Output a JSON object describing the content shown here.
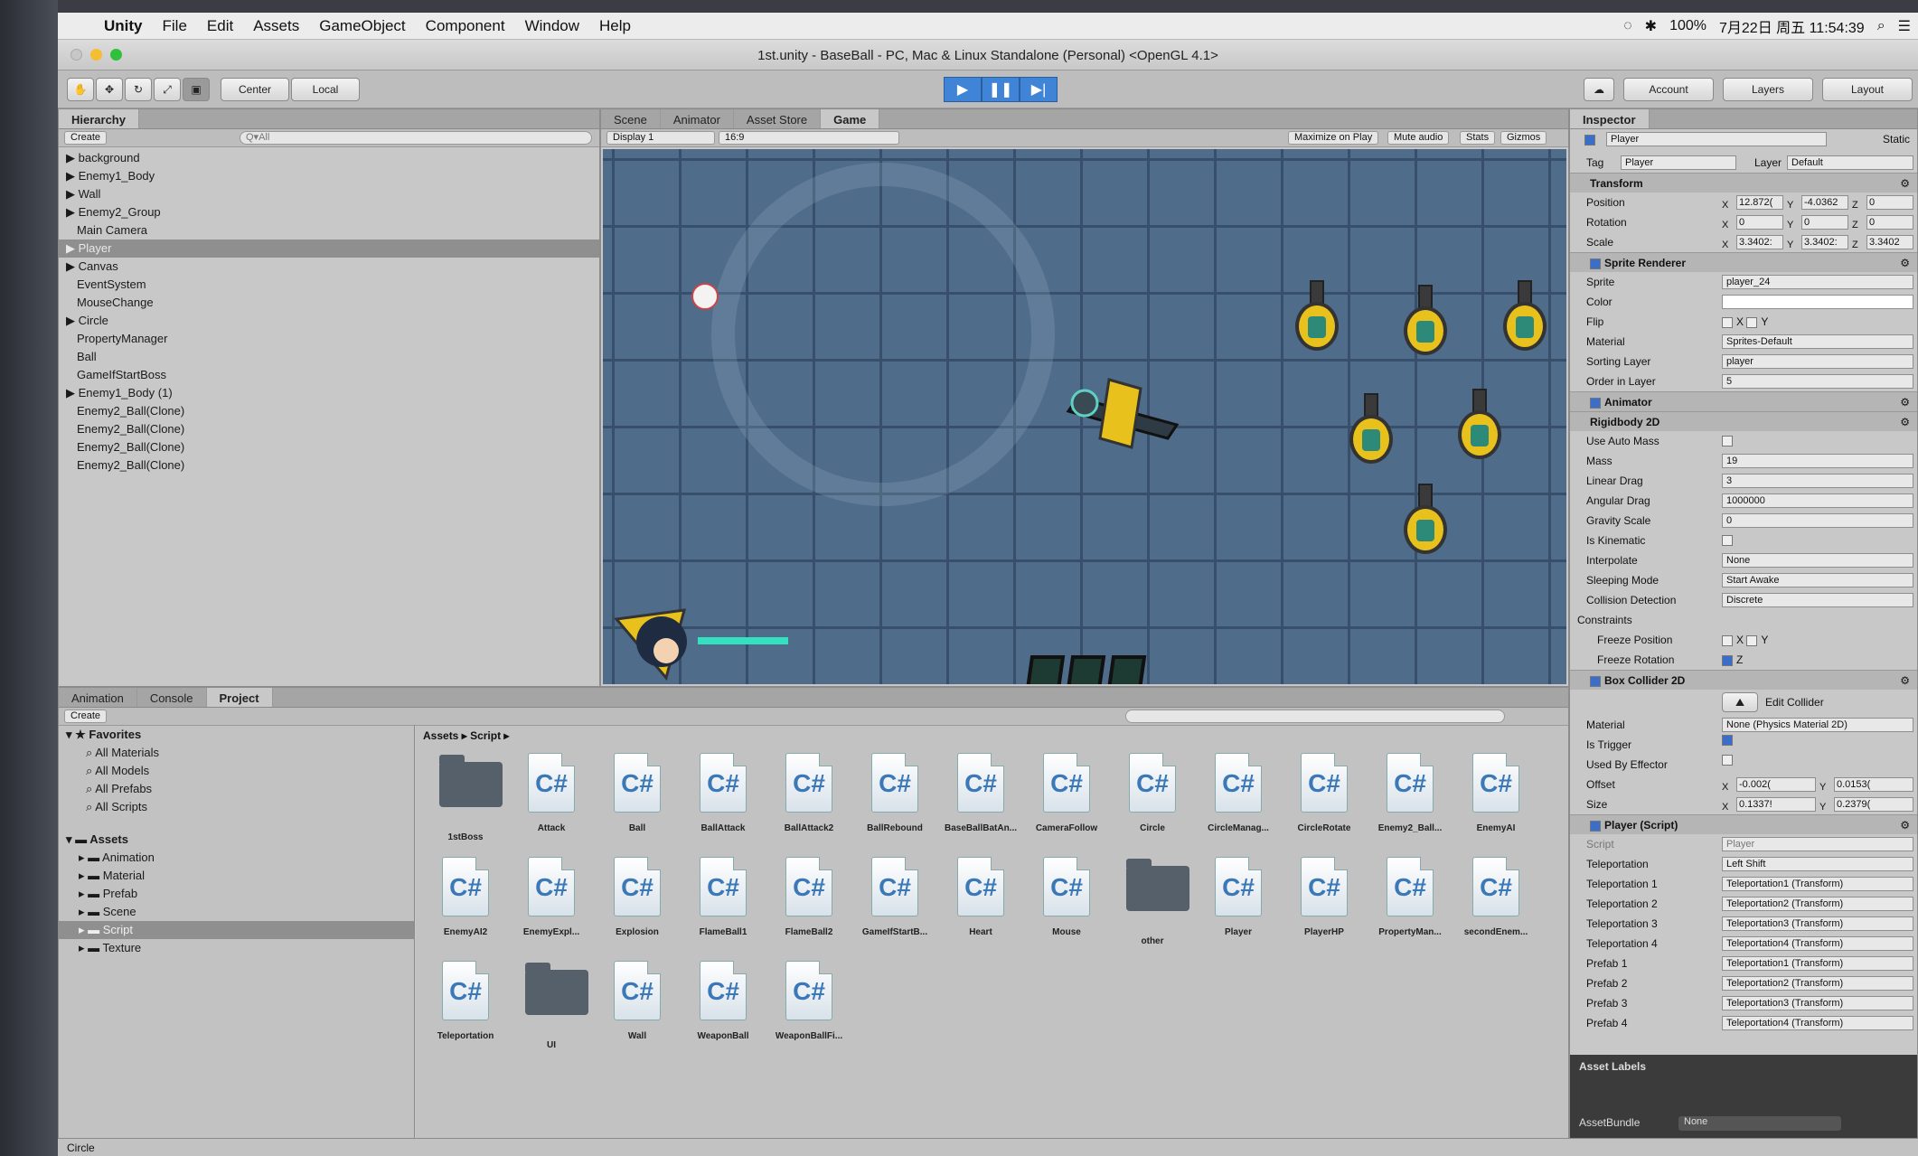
{
  "menubar": {
    "app": "Unity",
    "items": [
      "File",
      "Edit",
      "Assets",
      "GameObject",
      "Component",
      "Window",
      "Help"
    ],
    "status": {
      "battery": "100%",
      "date_time": "7月22日 周五 11:54:39"
    }
  },
  "window": {
    "title": "1st.unity - BaseBall - PC, Mac & Linux Standalone (Personal) <OpenGL 4.1>"
  },
  "toolbar": {
    "pivot": "Center",
    "space": "Local",
    "account": "Account",
    "layers": "Layers",
    "layout": "Layout"
  },
  "hierarchy": {
    "tab": "Hierarchy",
    "create": "Create",
    "search_placeholder": "Q▾All",
    "items": [
      {
        "label": "background",
        "fold": true
      },
      {
        "label": "Enemy1_Body",
        "fold": true
      },
      {
        "label": "Wall",
        "fold": true
      },
      {
        "label": "Enemy2_Group",
        "fold": true
      },
      {
        "label": "Main Camera",
        "fold": false
      },
      {
        "label": "Player",
        "fold": true,
        "selected": true
      },
      {
        "label": "Canvas",
        "fold": true
      },
      {
        "label": "EventSystem",
        "fold": false
      },
      {
        "label": "MouseChange",
        "fold": false
      },
      {
        "label": "Circle",
        "fold": true
      },
      {
        "label": "PropertyManager",
        "fold": false
      },
      {
        "label": "Ball",
        "fold": false
      },
      {
        "label": "GameIfStartBoss",
        "fold": false
      },
      {
        "label": "Enemy1_Body (1)",
        "fold": true
      },
      {
        "label": "Enemy2_Ball(Clone)",
        "fold": false
      },
      {
        "label": "Enemy2_Ball(Clone)",
        "fold": false
      },
      {
        "label": "Enemy2_Ball(Clone)",
        "fold": false
      },
      {
        "label": "Enemy2_Ball(Clone)",
        "fold": false
      }
    ]
  },
  "center_tabs": [
    "Scene",
    "Animator",
    "Asset Store",
    "Game"
  ],
  "game_bar": {
    "display": "Display 1",
    "aspect": "16:9",
    "options": [
      "Maximize on Play",
      "Mute audio",
      "Stats",
      "Gizmos"
    ]
  },
  "bottom_tabs": [
    "Animation",
    "Console",
    "Project"
  ],
  "project": {
    "create": "Create",
    "favorites_label": "Favorites",
    "favorites": [
      "All Materials",
      "All Models",
      "All Prefabs",
      "All Scripts"
    ],
    "assets_label": "Assets",
    "folders": [
      "Animation",
      "Material",
      "Prefab",
      "Scene",
      "Script",
      "Texture"
    ],
    "breadcrumb": [
      "Assets",
      "Script"
    ],
    "files": [
      {
        "name": "1stBoss",
        "kind": "folder"
      },
      {
        "name": "Attack",
        "kind": "cs"
      },
      {
        "name": "Ball",
        "kind": "cs"
      },
      {
        "name": "BallAttack",
        "kind": "cs"
      },
      {
        "name": "BallAttack2",
        "kind": "cs"
      },
      {
        "name": "BallRebound",
        "kind": "cs"
      },
      {
        "name": "BaseBallBatAn...",
        "kind": "cs"
      },
      {
        "name": "CameraFollow",
        "kind": "cs"
      },
      {
        "name": "Circle",
        "kind": "cs"
      },
      {
        "name": "CircleManag...",
        "kind": "cs"
      },
      {
        "name": "CircleRotate",
        "kind": "cs"
      },
      {
        "name": "Enemy2_Ball...",
        "kind": "cs"
      },
      {
        "name": "EnemyAI",
        "kind": "cs"
      },
      {
        "name": "EnemyAI2",
        "kind": "cs"
      },
      {
        "name": "EnemyExpl...",
        "kind": "cs"
      },
      {
        "name": "Explosion",
        "kind": "cs"
      },
      {
        "name": "FlameBall1",
        "kind": "cs"
      },
      {
        "name": "FlameBall2",
        "kind": "cs"
      },
      {
        "name": "GameIfStartB...",
        "kind": "cs"
      },
      {
        "name": "Heart",
        "kind": "cs"
      },
      {
        "name": "Mouse",
        "kind": "cs"
      },
      {
        "name": "other",
        "kind": "folder"
      },
      {
        "name": "Player",
        "kind": "cs"
      },
      {
        "name": "PlayerHP",
        "kind": "cs"
      },
      {
        "name": "PropertyMan...",
        "kind": "cs"
      },
      {
        "name": "secondEnem...",
        "kind": "cs"
      },
      {
        "name": "Teleportation",
        "kind": "cs"
      },
      {
        "name": "UI",
        "kind": "folder"
      },
      {
        "name": "Wall",
        "kind": "cs"
      },
      {
        "name": "WeaponBall",
        "kind": "cs"
      },
      {
        "name": "WeaponBallFi...",
        "kind": "cs"
      }
    ]
  },
  "inspector": {
    "tab": "Inspector",
    "object_name": "Player",
    "static_label": "Static",
    "tag_label": "Tag",
    "tag": "Player",
    "layer_label": "Layer",
    "layer": "Default",
    "transform": {
      "title": "Transform",
      "position": {
        "label": "Position",
        "x": "12.872(",
        "y": "-4.0362",
        "z": "0"
      },
      "rotation": {
        "label": "Rotation",
        "x": "0",
        "y": "0",
        "z": "0"
      },
      "scale": {
        "label": "Scale",
        "x": "3.3402:",
        "y": "3.3402:",
        "z": "3.3402"
      }
    },
    "sprite_renderer": {
      "title": "Sprite Renderer",
      "sprite": "player_24",
      "color_label": "Color",
      "flip_label": "Flip",
      "material": "Sprites-Default",
      "sorting_layer": "player",
      "order_in_layer": "5"
    },
    "animator_title": "Animator",
    "rigidbody": {
      "title": "Rigidbody 2D",
      "rows": [
        {
          "label": "Use Auto Mass",
          "value": ""
        },
        {
          "label": "Mass",
          "value": "19"
        },
        {
          "label": "Linear Drag",
          "value": "3"
        },
        {
          "label": "Angular Drag",
          "value": "1000000"
        },
        {
          "label": "Gravity Scale",
          "value": "0"
        },
        {
          "label": "Is Kinematic",
          "value": ""
        },
        {
          "label": "Interpolate",
          "value": "None"
        },
        {
          "label": "Sleeping Mode",
          "value": "Start Awake"
        },
        {
          "label": "Collision Detection",
          "value": "Discrete"
        }
      ],
      "constraints": "Constraints",
      "freeze_pos": "Freeze Position",
      "freeze_rot": "Freeze Rotation"
    },
    "box_collider": {
      "title": "Box Collider 2D",
      "edit": "Edit Collider",
      "material": "None (Physics Material 2D)",
      "offset": {
        "x": "-0.002(",
        "y": "0.0153("
      },
      "size": {
        "x": "0.1337!",
        "y": "0.2379("
      }
    },
    "player_script": {
      "title": "Player (Script)",
      "script": "Player",
      "rows": [
        {
          "label": "Teleportation",
          "value": "Left Shift"
        },
        {
          "label": "Teleportation 1",
          "value": "Teleportation1 (Transform)"
        },
        {
          "label": "Teleportation 2",
          "value": "Teleportation2 (Transform)"
        },
        {
          "label": "Teleportation 3",
          "value": "Teleportation3 (Transform)"
        },
        {
          "label": "Teleportation 4",
          "value": "Teleportation4 (Transform)"
        },
        {
          "label": "Prefab 1",
          "value": "Teleportation1 (Transform)"
        },
        {
          "label": "Prefab 2",
          "value": "Teleportation2 (Transform)"
        },
        {
          "label": "Prefab 3",
          "value": "Teleportation3 (Transform)"
        },
        {
          "label": "Prefab 4",
          "value": "Teleportation4 (Transform)"
        }
      ]
    },
    "asset_labels": "Asset Labels",
    "asset_bundle": "AssetBundle",
    "asset_bundle_value": "None"
  },
  "statusbar": {
    "text": "Circle"
  },
  "colors": {
    "play_active": "#3f84d6",
    "selection": "#8f8f8f",
    "game_bg": "#4f6c8b"
  }
}
